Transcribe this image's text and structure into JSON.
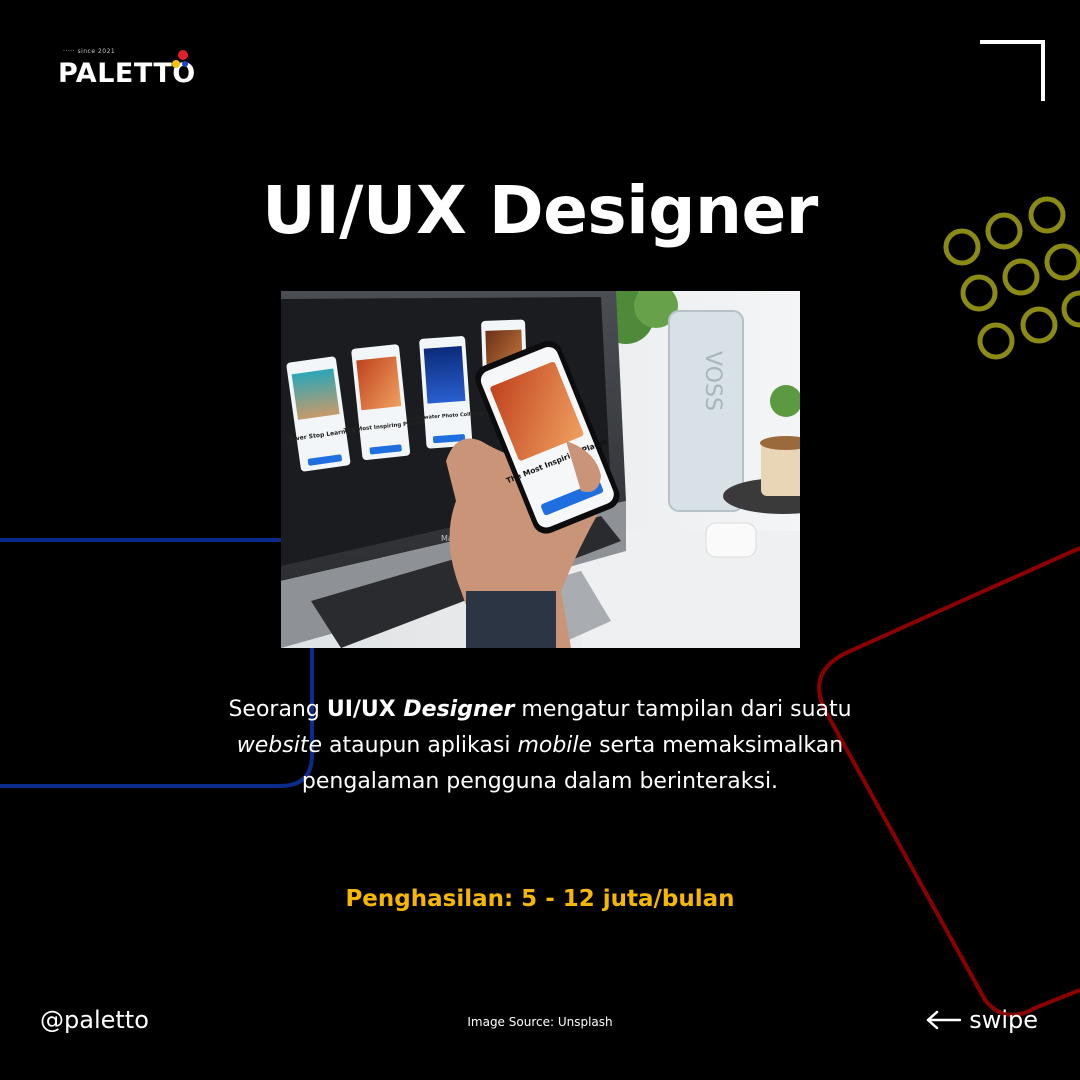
{
  "brand": {
    "name": "PALETTO",
    "tagline": "·····  since 2021"
  },
  "title": "UI/UX Designer",
  "photo": {
    "screens": [
      {
        "title": "Never Stop Learning"
      },
      {
        "title": "The Most Inspiring Places"
      },
      {
        "title": "Underwater Photo Collection"
      },
      {
        "title": ""
      }
    ],
    "phone_title": "The Most Inspiring Places",
    "laptop_label": "MacBook Pro",
    "bottle_label": "VOSS"
  },
  "description": {
    "p1": "Seorang ",
    "b1": "UI/UX ",
    "bi1": "Designer",
    "p2": " mengatur tampilan dari suatu ",
    "i1": "website",
    "p3": " ataupun aplikasi ",
    "i2": "mobile",
    "p4": " serta memaksimalkan pengalaman pengguna dalam berinteraksi."
  },
  "income": "Penghasilan: 5 - 12 juta/bulan",
  "footer": {
    "handle": "@paletto",
    "source": "Image Source: Unsplash",
    "swipe": "swipe"
  },
  "colors": {
    "background": "#000000",
    "accent_yellow": "#f5b700",
    "ring_olive": "#8a8a14",
    "line_blue": "#0a2a8c",
    "line_red": "#8b0000"
  }
}
